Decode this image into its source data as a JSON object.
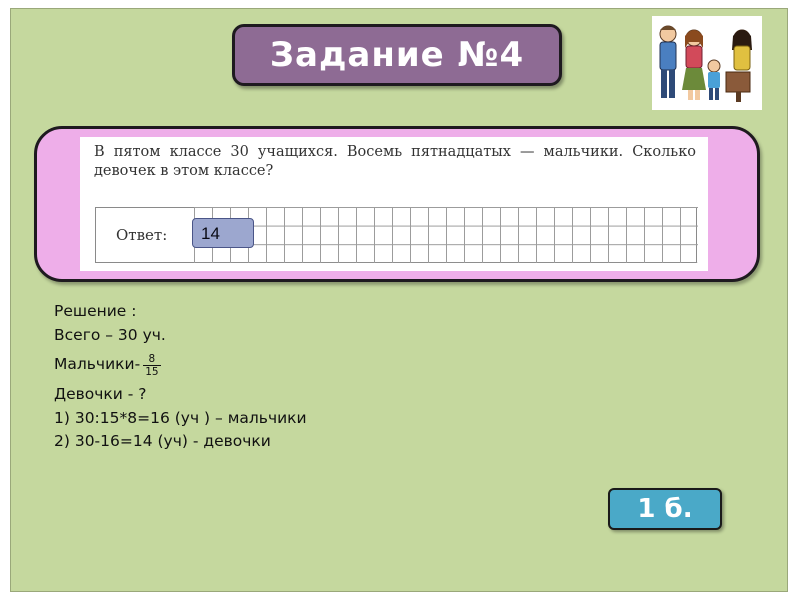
{
  "slide": {
    "title": "Задание №4",
    "family_image": "family-clipart-icon",
    "problem": {
      "text": "В пятом классе 30 учащихся. Восемь пятнадцатых — мальчики. Сколько девочек в этом классе?",
      "answer_label": "Ответ:",
      "answer_value": "14"
    },
    "solution": {
      "heading": "Решение :",
      "total": "Всего – 30 уч.",
      "boys_label": "Мальчики-",
      "boys_fraction": {
        "numerator": "8",
        "denominator": "15"
      },
      "girls_label": "Девочки - ?",
      "step1": "1) 30:15*8=16 (уч ) – мальчики",
      "step2": "2) 30-16=14 (уч) - девочки"
    },
    "score": "1 б."
  },
  "colors": {
    "background": "#c5d89e",
    "title_box": "#8e6b94",
    "problem_panel": "#eeaee9",
    "answer_chip": "#9ca7cf",
    "score_badge": "#4aa9c8"
  }
}
